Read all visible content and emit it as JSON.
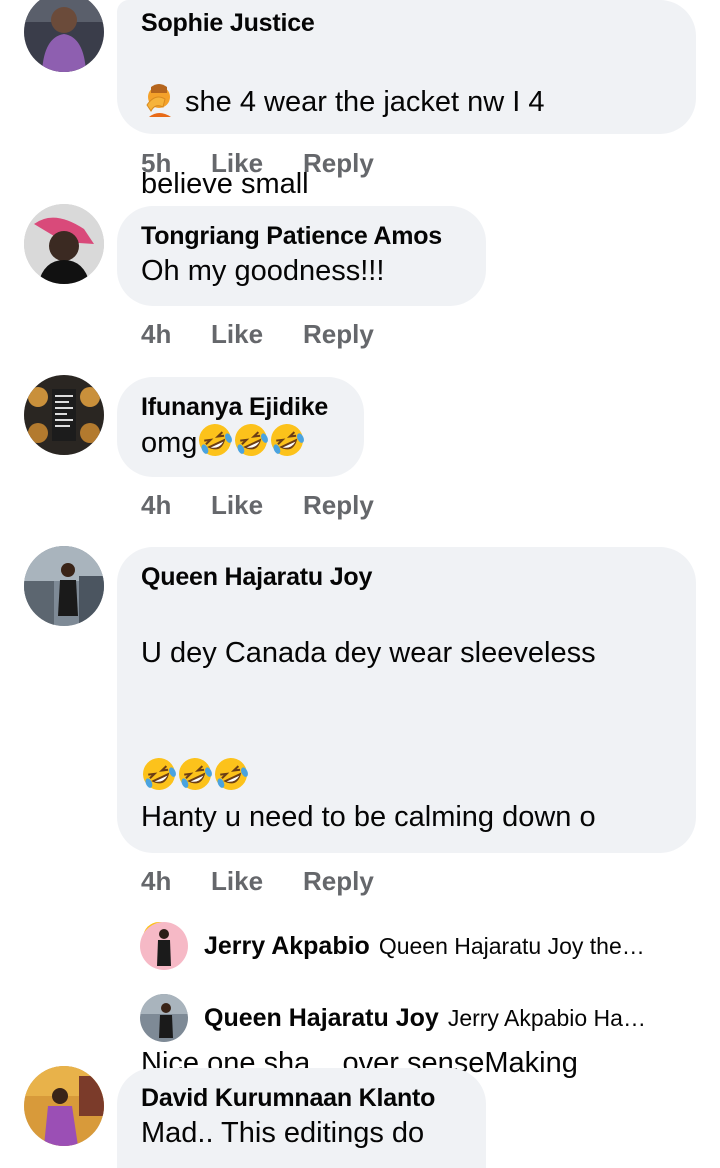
{
  "comments": [
    {
      "author": "Sophie Justice",
      "line1": " she  4 wear the jacket nw I 4",
      "line2": "believe small",
      "time": "5h",
      "like": "Like",
      "reply": "Reply"
    },
    {
      "author": "Tongriang Patience Amos",
      "text": "Oh my goodness!!!",
      "time": "4h",
      "like": "Like",
      "reply": "Reply"
    },
    {
      "author": "Ifunanya Ejidike",
      "text": "omg",
      "time": "4h",
      "like": "Like",
      "reply": "Reply"
    },
    {
      "author": "Queen Hajaratu Joy",
      "line1": "U dey Canada dey wear sleeveless",
      "line3": "Hanty u need to be calming down o",
      "line5": "Nice one sha....over senseMaking",
      "time": "4h",
      "like": "Like",
      "reply": "Reply"
    },
    {
      "author": "David Kurumnaan Klanto",
      "text": "Mad.. This editings do"
    }
  ],
  "replies": [
    {
      "author": "Jerry Akpabio",
      "snippet": "Queen Hajaratu Joy the…"
    },
    {
      "author": "Queen Hajaratu Joy",
      "snippet": "Jerry Akpabio Ha…"
    }
  ],
  "emoji": {
    "facepalm": "person-facepalming",
    "rofl": "rolling-on-floor-laughing",
    "grin": "grinning-squinting-face"
  }
}
